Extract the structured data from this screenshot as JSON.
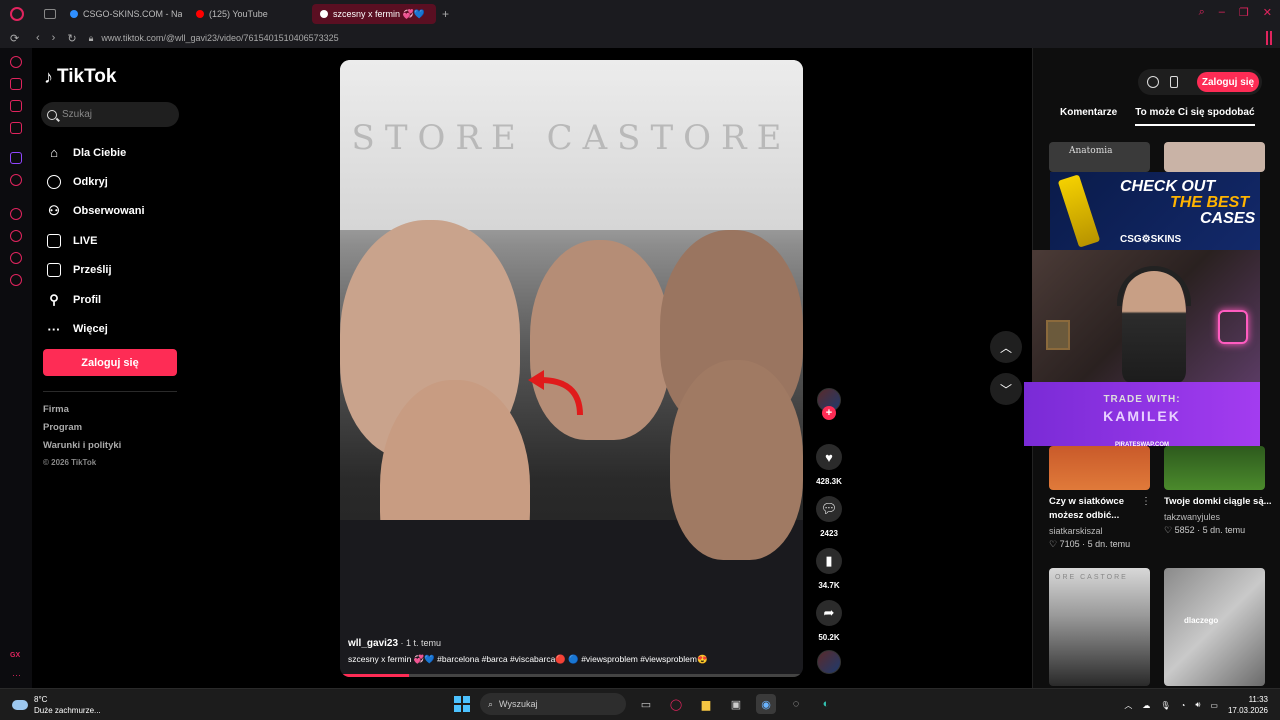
{
  "browser": {
    "tabs": [
      {
        "label": "CSGO-SKINS.COM - Najle",
        "color": "#2f8fff"
      },
      {
        "label": "(125) YouTube",
        "color": "#ff0000"
      },
      {
        "label": "szcesny x fermin 💞💙",
        "color": "#ffffff",
        "active": true
      }
    ],
    "url": "www.tiktok.com/@wll_gavi23/video/7615401510406573325"
  },
  "sidebar": {
    "logo": "TikTok",
    "search_placeholder": "Szukaj",
    "menu": [
      {
        "label": "Dla Ciebie",
        "icon": "home-icon"
      },
      {
        "label": "Odkryj",
        "icon": "compass-icon"
      },
      {
        "label": "Obserwowani",
        "icon": "following-icon"
      },
      {
        "label": "LIVE",
        "icon": "live-icon"
      },
      {
        "label": "Prześlij",
        "icon": "upload-icon"
      },
      {
        "label": "Profil",
        "icon": "profile-icon"
      },
      {
        "label": "Więcej",
        "icon": "more-icon"
      }
    ],
    "login_label": "Zaloguj się",
    "footer": [
      "Firma",
      "Program",
      "Warunki i polityki"
    ],
    "copyright": "© 2026 TikTok"
  },
  "video": {
    "brand_text": "STORE  CASTORE",
    "author": "wll_gavi23",
    "time": " · 1 t. temu",
    "description": "szcesny x fermin 💞💙 #barcelona #barca #viscabarca🔴 🔵 #viewsproblem #viewsproblem😍",
    "progress": 0.15
  },
  "actions": {
    "likes": "428.3K",
    "comments": "2423",
    "saves": "34.7K",
    "shares": "50.2K"
  },
  "right_panel": {
    "login_label": "Zaloguj się",
    "tabs": [
      "Komentarze",
      "To może Ci się spodobać"
    ],
    "cards": [
      {
        "title": "Czy w siatkówce możesz odbić...",
        "author": "siatkarskiszal",
        "likes": "7105",
        "date": "5 dn. temu"
      },
      {
        "title": "Twoje domki ciągle są...",
        "author": "takzwanyjules",
        "likes": "5852",
        "date": "5 dn. temu"
      }
    ],
    "thumb_texts": {
      "anatomia": "Anatomia",
      "dlaczego": "dlaczego",
      "castore": "ORE CASTORE"
    }
  },
  "overlay": {
    "ad1": {
      "check": "CHECK  OUT",
      "best": "THE BEST",
      "cases": "CASES",
      "brand": "CSG⚙SKINS"
    },
    "ad2": {
      "line1": "TRADE WITH:",
      "line2": "KAMILEK",
      "line3": "PIRATESWAP.COM"
    }
  },
  "taskbar": {
    "temp": "8°C",
    "weather": "Duże zachmurze...",
    "search": "Wyszukaj",
    "time": "11:33",
    "date": "17.03.2026"
  }
}
